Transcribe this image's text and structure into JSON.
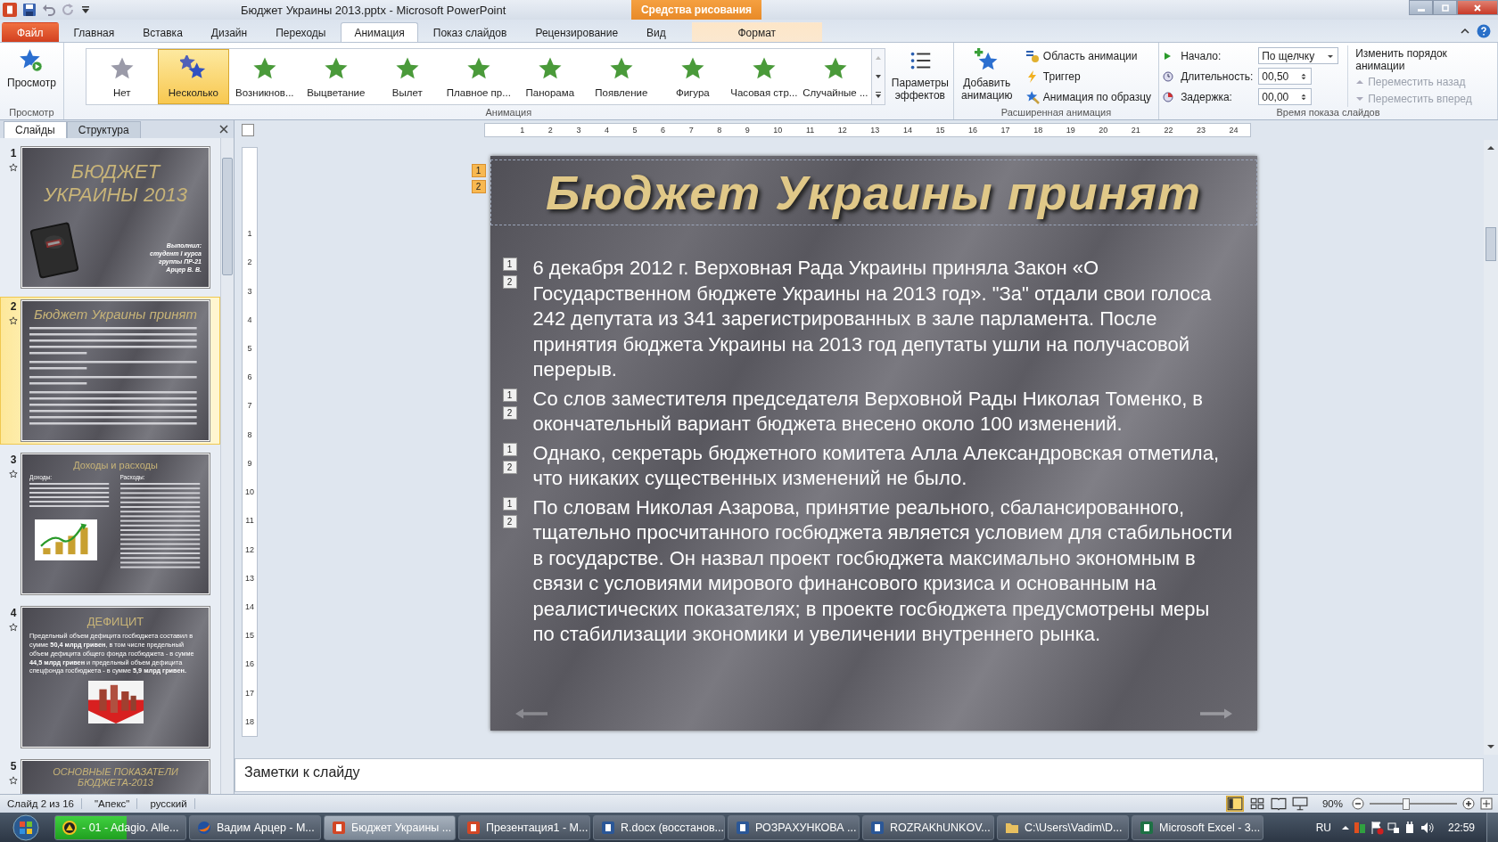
{
  "window": {
    "title": "Бюджет Украины 2013.pptx - Microsoft PowerPoint"
  },
  "contextual_tab": {
    "group": "Средства рисования",
    "tab": "Формат"
  },
  "tabs": [
    {
      "label": "Файл",
      "kind": "file",
      "selected": false
    },
    {
      "label": "Главная",
      "kind": "normal",
      "selected": false
    },
    {
      "label": "Вставка",
      "kind": "normal",
      "selected": false
    },
    {
      "label": "Дизайн",
      "kind": "normal",
      "selected": false
    },
    {
      "label": "Переходы",
      "kind": "normal",
      "selected": false
    },
    {
      "label": "Анимация",
      "kind": "normal",
      "selected": true
    },
    {
      "label": "Показ слайдов",
      "kind": "normal",
      "selected": false
    },
    {
      "label": "Рецензирование",
      "kind": "normal",
      "selected": false
    },
    {
      "label": "Вид",
      "kind": "normal",
      "selected": false
    }
  ],
  "ribbon": {
    "preview": {
      "button": "Просмотр",
      "group": "Просмотр"
    },
    "animation_gallery": {
      "group": "Анимация",
      "items": [
        {
          "label": "Нет",
          "kind": "none",
          "selected": false
        },
        {
          "label": "Несколько",
          "kind": "multiple",
          "selected": true
        },
        {
          "label": "Возникнов...",
          "kind": "effect",
          "selected": false
        },
        {
          "label": "Выцветание",
          "kind": "effect",
          "selected": false
        },
        {
          "label": "Вылет",
          "kind": "effect",
          "selected": false
        },
        {
          "label": "Плавное пр...",
          "kind": "effect",
          "selected": false
        },
        {
          "label": "Панорама",
          "kind": "effect",
          "selected": false
        },
        {
          "label": "Появление",
          "kind": "effect",
          "selected": false
        },
        {
          "label": "Фигура",
          "kind": "effect",
          "selected": false
        },
        {
          "label": "Часовая стр...",
          "kind": "effect",
          "selected": false
        },
        {
          "label": "Случайные ...",
          "kind": "effect",
          "selected": false
        }
      ]
    },
    "effect_options": "Параметры эффектов",
    "advanced": {
      "group": "Расширенная анимация",
      "add": "Добавить анимацию",
      "items": [
        "Область анимации",
        "Триггер",
        "Анимация по образцу"
      ]
    },
    "timing": {
      "group": "Время показа слайдов",
      "start_label": "Начало:",
      "start_value": "По щелчку",
      "duration_label": "Длительность:",
      "duration_value": "00,50",
      "delay_label": "Задержка:",
      "delay_value": "00,00",
      "reorder_title": "Изменить порядок анимации",
      "move_back": {
        "label": "Переместить назад",
        "disabled": true
      },
      "move_forward": {
        "label": "Переместить вперед",
        "disabled": true
      }
    }
  },
  "slides_panel": {
    "tabs": [
      {
        "label": "Слайды",
        "selected": true
      },
      {
        "label": "Структура",
        "selected": false
      }
    ],
    "thumbnails": [
      {
        "number": "1",
        "kind": "cover",
        "title": "БЮДЖЕТ УКРАИНЫ 2013",
        "lines": [
          "Выполнил:",
          "студент I курса",
          "группы ПР-21",
          "Арцер В. В."
        ],
        "selected": false
      },
      {
        "number": "2",
        "kind": "text",
        "title": "Бюджет Украины принят",
        "selected": true
      },
      {
        "number": "3",
        "kind": "columns",
        "title": "Доходы и расходы",
        "columns": [
          "Доходы:",
          "Расходы:"
        ],
        "selected": false
      },
      {
        "number": "4",
        "kind": "deficit",
        "title": "ДЕФИЦИТ",
        "body": "Предельный объем дефицита госбюджета составил в сумме **50,4 млрд гривен**, в том числе предельный объем дефицита общего фонда госбюджета - в сумме **44,5 млрд гривен** и предельный объем дефицита спецфонда госбюджета - в сумме **5,9 млрд гривен.**",
        "selected": false
      },
      {
        "number": "5",
        "kind": "heading",
        "title": "ОСНОВНЫЕ ПОКАЗАТЕЛИ БЮДЖЕТА-2013",
        "selected": false
      }
    ]
  },
  "ruler": {
    "horizontal": [
      "1",
      "2",
      "3",
      "4",
      "5",
      "6",
      "7",
      "8",
      "9",
      "10",
      "11",
      "12",
      "13",
      "14",
      "15",
      "16",
      "17",
      "18",
      "19",
      "20",
      "21",
      "22",
      "23",
      "24"
    ],
    "vertical": [
      "1",
      "2",
      "3",
      "4",
      "5",
      "6",
      "7",
      "8",
      "9",
      "10",
      "11",
      "12",
      "13",
      "14",
      "15",
      "16",
      "17",
      "18"
    ]
  },
  "slide": {
    "title": "Бюджет Украины принят",
    "title_markers": [
      "1",
      "2"
    ],
    "paragraphs": [
      {
        "markers": [
          "1",
          "2"
        ],
        "text": "6 декабря 2012 г. Верховная Рада Украины приняла Закон «О Государственном бюджете Украины на 2013 год». \"За\" отдали свои голоса 242 депутата из 341 зарегистрированных в зале парламента. После принятия бюджета Украины на 2013 год депутаты ушли на получасовой перерыв."
      },
      {
        "markers": [
          "1",
          "2"
        ],
        "text": "Со слов заместителя председателя Верховной Рады Николая Томенко, в окончательный вариант бюджета внесено около 100 изменений."
      },
      {
        "markers": [
          "1",
          "2"
        ],
        "text": "Однако, секретарь бюджетного комитета Алла Александровская отметила, что никаких существенных изменений не было."
      },
      {
        "markers": [
          "1",
          "2"
        ],
        "text": "По словам Николая Азарова, принятие реального, сбалансированного, тщательно просчитанного госбюджета является условием для стабильности в государстве. Он назвал проект госбюджета максимально экономным в связи с условиями мирового финансового кризиса и основанным на реалистических показателях; в проекте госбюджета предусмотрены меры по стабилизации экономики и увеличении внутреннего рынка."
      }
    ]
  },
  "notes": {
    "placeholder": "Заметки к слайду"
  },
  "status_bar": {
    "slide": "Слайд 2 из 16",
    "theme": "\"Апекс\"",
    "language": "русский",
    "zoom": "90%",
    "level": 0.42
  },
  "taskbar": {
    "items": [
      {
        "label": "- 01 - Adagio. Alle...",
        "kind": "player",
        "selected": false,
        "level": 0.55
      },
      {
        "label": "Вадим Арцер - М...",
        "kind": "browser",
        "selected": false
      },
      {
        "label": "Бюджет Украины ...",
        "kind": "ppt",
        "selected": true
      },
      {
        "label": "Презентация1 - М...",
        "kind": "ppt",
        "selected": false
      },
      {
        "label": "R.docx (восстанов...",
        "kind": "word",
        "selected": false
      },
      {
        "label": "РОЗРАХУНКОВА ...",
        "kind": "word",
        "selected": false
      },
      {
        "label": "ROZRAKhUNKOV...",
        "kind": "word",
        "selected": false
      },
      {
        "label": "C:\\Users\\Vadim\\D...",
        "kind": "folder",
        "selected": false
      },
      {
        "label": "Microsoft Excel - 3...",
        "kind": "excel",
        "selected": false
      }
    ],
    "language": "RU",
    "clock": "22:59"
  }
}
